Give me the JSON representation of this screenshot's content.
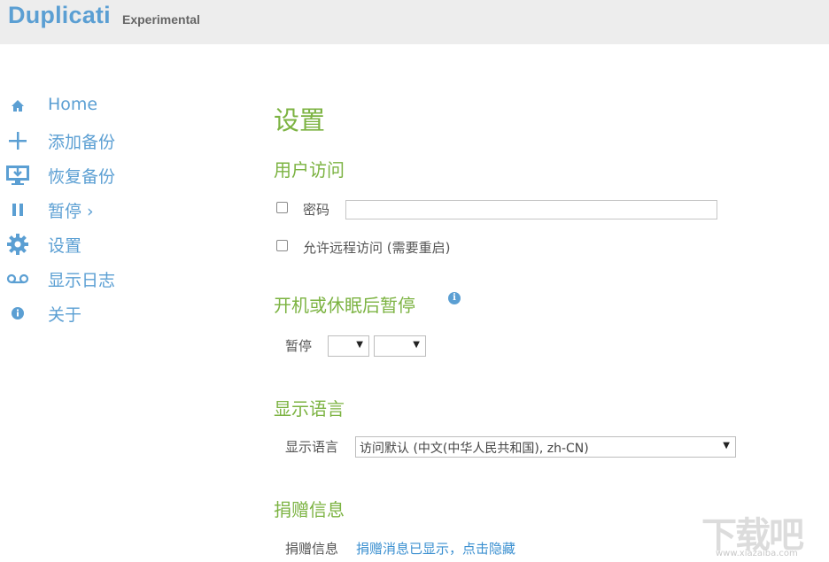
{
  "header": {
    "brand": "Duplicati",
    "subtitle": "Experimental"
  },
  "nav": {
    "items": [
      {
        "label": "Home",
        "icon": "home-icon"
      },
      {
        "label": "添加备份",
        "icon": "plus-icon"
      },
      {
        "label": "恢复备份",
        "icon": "restore-icon"
      },
      {
        "label": "暂停",
        "icon": "pause-icon"
      },
      {
        "label": "设置",
        "icon": "gear-icon"
      },
      {
        "label": "显示日志",
        "icon": "log-icon"
      },
      {
        "label": "关于",
        "icon": "info-icon"
      }
    ],
    "pause_chevron": "›"
  },
  "main": {
    "title": "设置",
    "user_access": {
      "heading": "用户访问",
      "password_label": "密码",
      "password_value": "",
      "remote_label": "允许远程访问 (需要重启)"
    },
    "pause_after": {
      "heading": "开机或休眠后暂停",
      "label": "暂停",
      "value1": "",
      "value2": ""
    },
    "language": {
      "heading": "显示语言",
      "label": "显示语言",
      "selected": "访问默认 (中文(中华人民共和国), zh-CN)"
    },
    "donation": {
      "heading": "捐赠信息",
      "label": "捐赠信息",
      "link": "捐赠消息已显示，点击隐藏"
    }
  },
  "watermark": {
    "text": "下载吧",
    "url": "www.xiazaiba.com"
  },
  "colors": {
    "brand_blue": "#5b9fd3",
    "heading_green": "#7cb342",
    "topbar_gray": "#ededed"
  }
}
